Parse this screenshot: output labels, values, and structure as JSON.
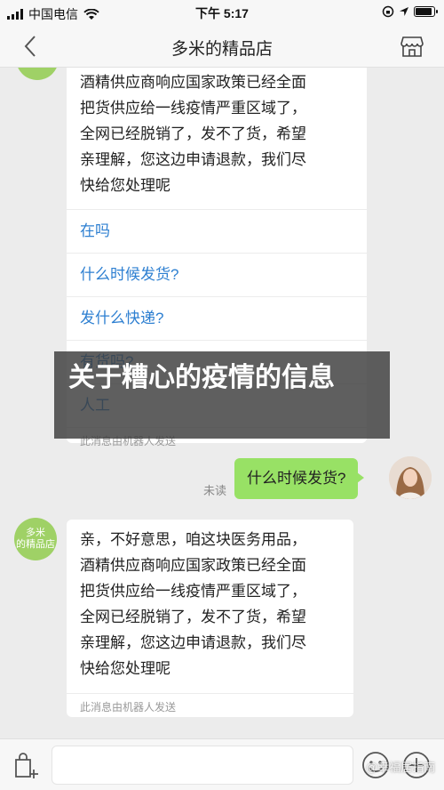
{
  "status_bar": {
    "carrier": "中国电信",
    "time": "下午 5:17"
  },
  "nav": {
    "title": "多米的精品店"
  },
  "shop": {
    "avatar_text": "多米\n的精品店"
  },
  "messages": {
    "bot_reply_1": [
      "酒精供应商响应国家政策已经全面",
      "把货供应给一线疫情严重区域了，",
      "全网已经脱销了，发不了货，希望",
      "亲理解，您这边申请退款，我们尽",
      "快给您处理呢"
    ],
    "quick_questions": [
      "在吗",
      "什么时候发货?",
      "发什么快递?",
      "有货吗?",
      "人工"
    ],
    "bot_note": "此消息由机器人发送",
    "user_message": "什么时候发货?",
    "read_status": "未读",
    "bot_reply_2": [
      "亲，不好意思，咱这块医务用品，",
      "酒精供应商响应国家政策已经全面",
      "把货供应给一线疫情严重区域了，",
      "全网已经脱销了，发不了货，希望",
      "亲理解，您这边申请退款，我们尽",
      "快给您处理呢"
    ],
    "bot_note_2": "此消息由机器人发送"
  },
  "banner": {
    "text": "关于糟心的疫情的信息"
  },
  "input_bar": {
    "value": "",
    "placeholder": ""
  },
  "watermark": "@幸福居指南",
  "colors": {
    "user_bubble": "#98e165",
    "link": "#2d7fd1",
    "shop_avatar": "#9fd166"
  }
}
